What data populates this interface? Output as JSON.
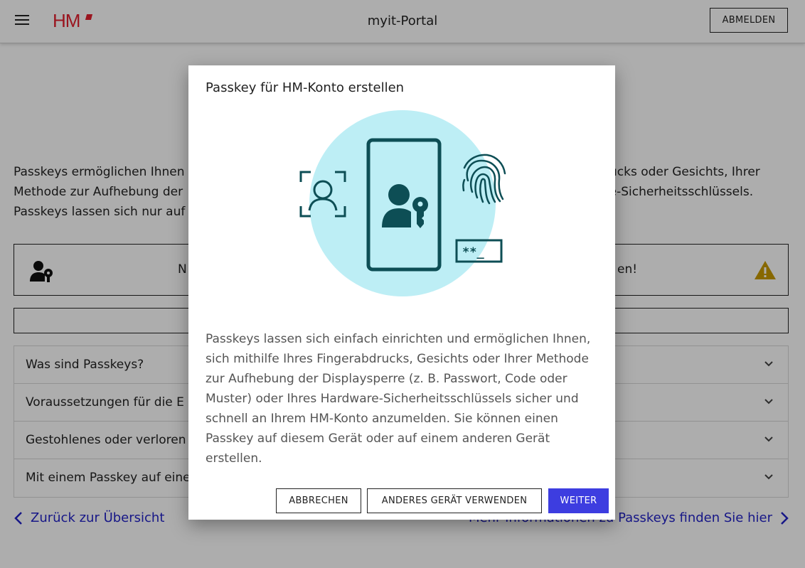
{
  "header": {
    "logo": "HM",
    "title": "myit-Portal",
    "logout_label": "ABMELDEN"
  },
  "page": {
    "intro_lines": [
      "Passkeys ermöglichen Ihnen",
      "Methode zur Aufhebung der",
      "Passkeys lassen sich nur auf"
    ],
    "intro_right_lines": [
      "rucks oder Gesichts, Ihrer",
      "re-Sicherheitsschlüssels."
    ],
    "notice_left": "N",
    "notice_right": "en!",
    "accordion": [
      {
        "label": "Was sind Passkeys?"
      },
      {
        "label": "Voraussetzungen für die E"
      },
      {
        "label": "Gestohlenes oder verloren"
      },
      {
        "label": "Mit einem Passkey auf eine"
      }
    ],
    "back_link": "Zurück zur Übersicht",
    "more_link": "Mehr Informationen zu Passkeys finden Sie hier"
  },
  "dialog": {
    "title": "Passkey für HM-Konto erstellen",
    "password_text": "**_",
    "body": "Passkeys lassen sich einfach einrichten und ermöglichen Ihnen, sich mithilfe Ihres Fingerabdrucks, Gesichts oder Ihrer Methode zur Aufhebung der Displaysperre (z. B. Passwort, Code oder Muster) oder Ihres Hardware-Sicherheitsschlüssels sicher und schnell an Ihrem HM-Konto anzumelden. Sie können einen Passkey auf diesem Gerät oder auf einem anderen Gerät erstellen.",
    "cancel_label": "ABBRECHEN",
    "other_device_label": "ANDERES GERÄT VERWENDEN",
    "next_label": "WEITER"
  },
  "colors": {
    "accent": "#3d3de0",
    "brand": "#e4202f",
    "link": "#2323c8",
    "illustration_bg": "#bdeef5",
    "illustration_stroke": "#0d4e55",
    "warning": "#c79a00"
  }
}
